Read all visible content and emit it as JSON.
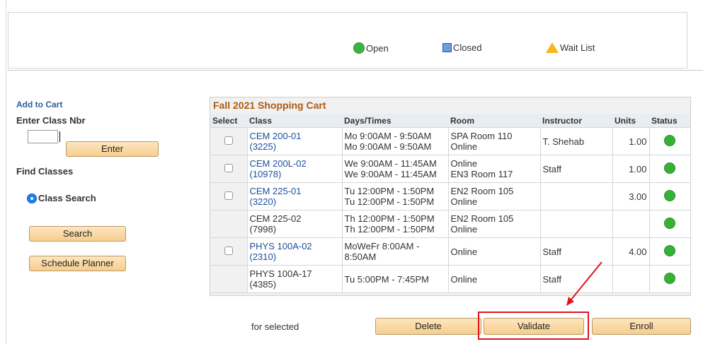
{
  "legend": {
    "open_label": "Open",
    "closed_label": "Closed",
    "waitlist_label": "Wait List",
    "open_color": "#3fb33f",
    "closed_color": "#6f9be3",
    "waitlist_color": "#f3b81a"
  },
  "left": {
    "add_to_cart": "Add to Cart",
    "enter_class_nbr": "Enter Class Nbr",
    "class_nbr_value": "",
    "enter_button": "Enter",
    "find_classes": "Find Classes",
    "class_search_label": "Class Search",
    "search_button": "Search",
    "schedule_planner_button": "Schedule Planner"
  },
  "cart": {
    "title": "Fall 2021 Shopping Cart",
    "columns": [
      "Select",
      "Class",
      "Days/Times",
      "Room",
      "Instructor",
      "Units",
      "Status"
    ],
    "rows": [
      {
        "selectable": true,
        "class_code": "CEM 200-01",
        "class_nbr": "(3225)",
        "link": true,
        "days1": "Mo 9:00AM - 9:50AM",
        "days2": "Mo 9:00AM - 9:50AM",
        "room1": "SPA  Room 110",
        "room2": "Online",
        "instructor": "T. Shehab",
        "units": "1.00",
        "status": "open"
      },
      {
        "selectable": true,
        "class_code": "CEM 200L-02",
        "class_nbr": "(10978)",
        "link": true,
        "days1": "We 9:00AM - 11:45AM",
        "days2": "We 9:00AM - 11:45AM",
        "room1": "Online",
        "room2": "EN3  Room 117",
        "instructor": "Staff",
        "units": "1.00",
        "status": "open"
      },
      {
        "selectable": true,
        "class_code": "CEM 225-01",
        "class_nbr": "(3220)",
        "link": true,
        "days1": "Tu 12:00PM - 1:50PM",
        "days2": "Tu 12:00PM - 1:50PM",
        "room1": "EN2  Room 105",
        "room2": "Online",
        "instructor": "",
        "units": "3.00",
        "status": "open"
      },
      {
        "selectable": false,
        "class_code": "CEM 225-02",
        "class_nbr": "(7998)",
        "link": false,
        "days1": "Th 12:00PM - 1:50PM",
        "days2": "Th 12:00PM - 1:50PM",
        "room1": "EN2  Room 105",
        "room2": "Online",
        "instructor": "",
        "units": "",
        "status": "open"
      },
      {
        "selectable": true,
        "class_code": "PHYS 100A-02",
        "class_nbr": "(2310)",
        "link": true,
        "days1": "MoWeFr 8:00AM -",
        "days2": "8:50AM",
        "room1": "Online",
        "room2": "",
        "instructor": "Staff",
        "units": "4.00",
        "status": "open"
      },
      {
        "selectable": false,
        "class_code": "PHYS 100A-17",
        "class_nbr": "(4385)",
        "link": false,
        "days1": "Tu 5:00PM - 7:45PM",
        "days2": "",
        "room1": "Online",
        "room2": "",
        "instructor": "Staff",
        "units": "",
        "status": "open"
      }
    ]
  },
  "actions": {
    "for_selected": "for selected",
    "delete_button": "Delete",
    "validate_button": "Validate",
    "enroll_button": "Enroll"
  },
  "annotation": {
    "highlight_color": "#e0141e"
  }
}
